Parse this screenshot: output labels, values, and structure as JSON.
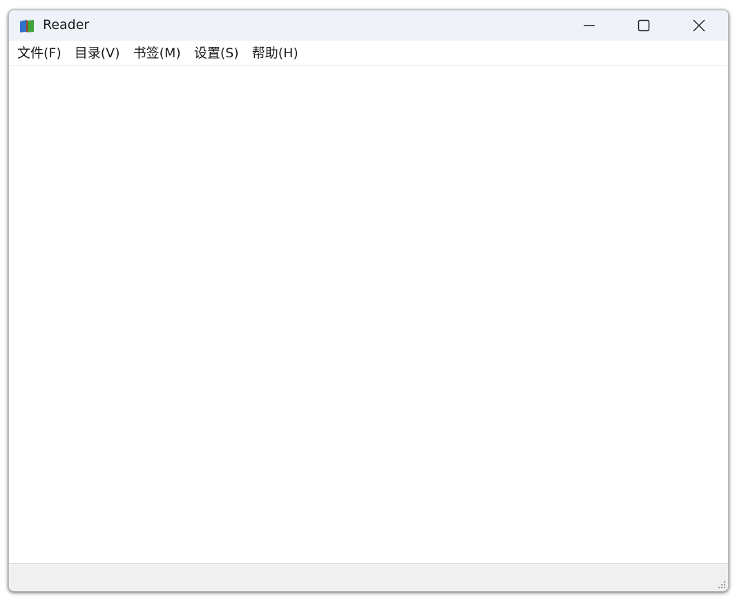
{
  "window": {
    "title": "Reader",
    "app_icon": "book-icon",
    "controls": {
      "minimize": "minimize-icon",
      "maximize": "maximize-icon",
      "close": "close-icon"
    }
  },
  "menu": {
    "items": [
      {
        "label": "文件(F)"
      },
      {
        "label": "目录(V)"
      },
      {
        "label": "书签(M)"
      },
      {
        "label": "设置(S)"
      },
      {
        "label": "帮助(H)"
      }
    ]
  },
  "statusbar": {
    "grip_icon": "resize-grip-icon"
  },
  "colors": {
    "titlebar_bg": "#eff3f9",
    "content_bg": "#ffffff",
    "statusbar_bg": "#f0f0f0"
  }
}
